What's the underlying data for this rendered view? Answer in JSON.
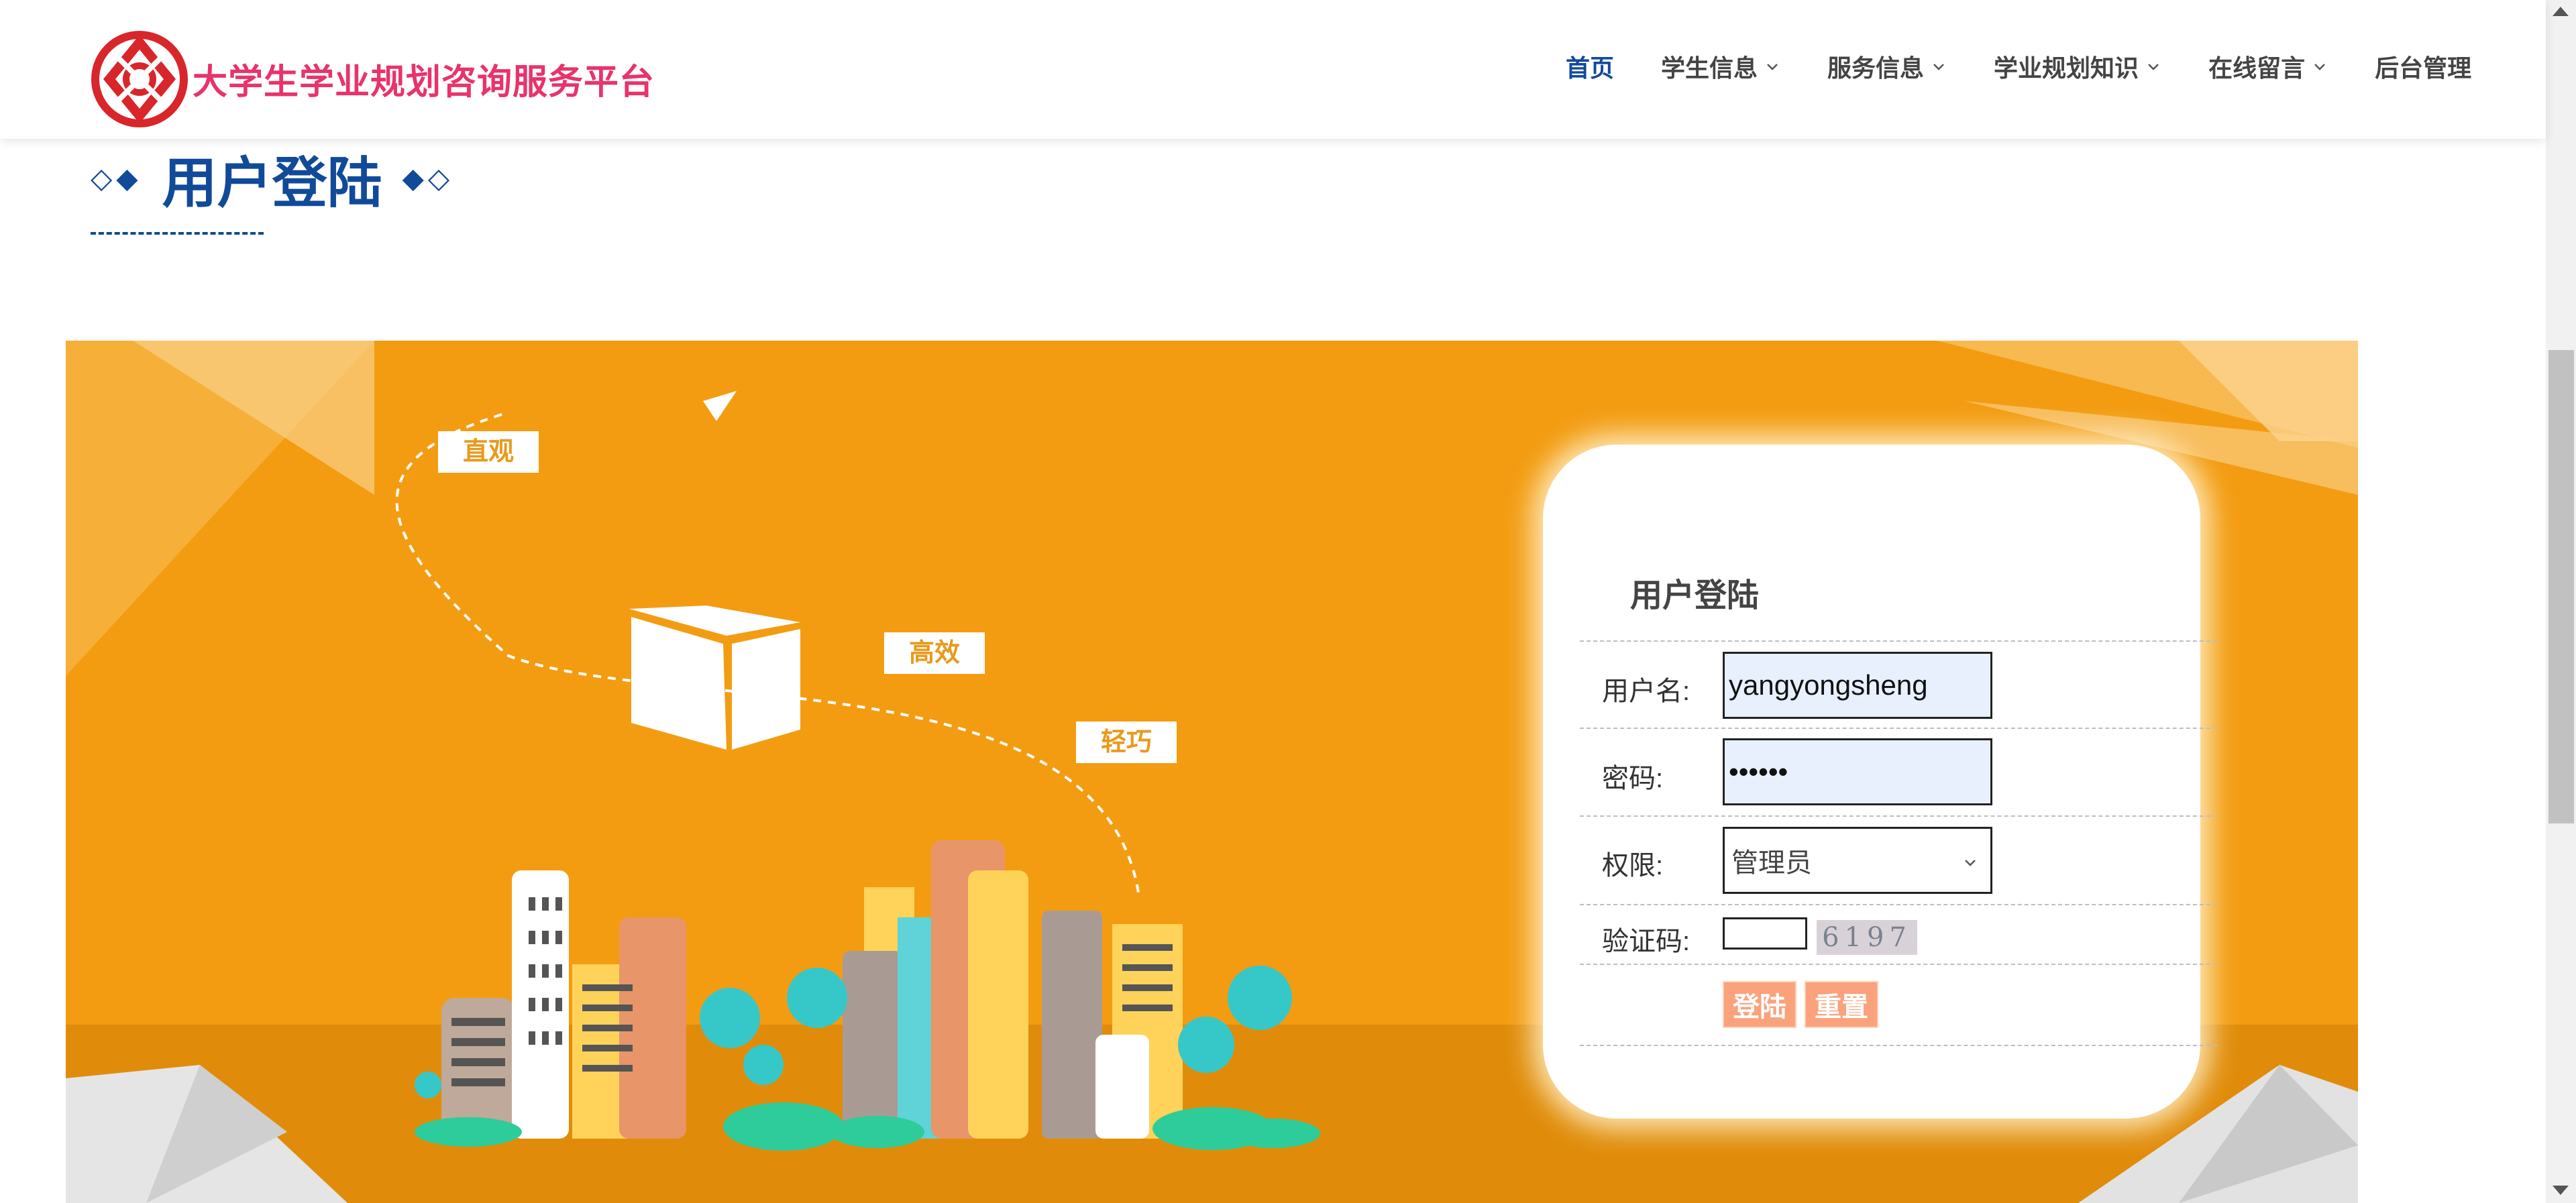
{
  "brand": {
    "name": "大学生学业规划咨询服务平台",
    "logo_icon": "red-knot-logo-icon"
  },
  "nav": {
    "items": [
      {
        "label": "首页",
        "active": true,
        "dropdown": false
      },
      {
        "label": "学生信息",
        "active": false,
        "dropdown": true
      },
      {
        "label": "服务信息",
        "active": false,
        "dropdown": true
      },
      {
        "label": "学业规划知识",
        "active": false,
        "dropdown": true
      },
      {
        "label": "在线留言",
        "active": false,
        "dropdown": true
      },
      {
        "label": "后台管理",
        "active": false,
        "dropdown": false
      }
    ]
  },
  "page": {
    "title": "用户登陆",
    "title_deco_left": "◇◆",
    "title_deco_right": "◆◇"
  },
  "banner": {
    "bubbles": [
      "直观",
      "高效",
      "轻巧"
    ]
  },
  "login": {
    "title": "用户登陆",
    "username_label": "用户名:",
    "username_value": "yangyongsheng",
    "password_label": "密码:",
    "password_value": "••••••",
    "role_label": "权限:",
    "role_value": "管理员",
    "captcha_label": "验证码:",
    "captcha_input_value": "",
    "captcha_code": "6197",
    "login_button": "登陆",
    "reset_button": "重置"
  },
  "colors": {
    "brand": "#e8336b",
    "primary": "#114a99",
    "banner": "#f39c12",
    "button": "#f9a27c"
  }
}
